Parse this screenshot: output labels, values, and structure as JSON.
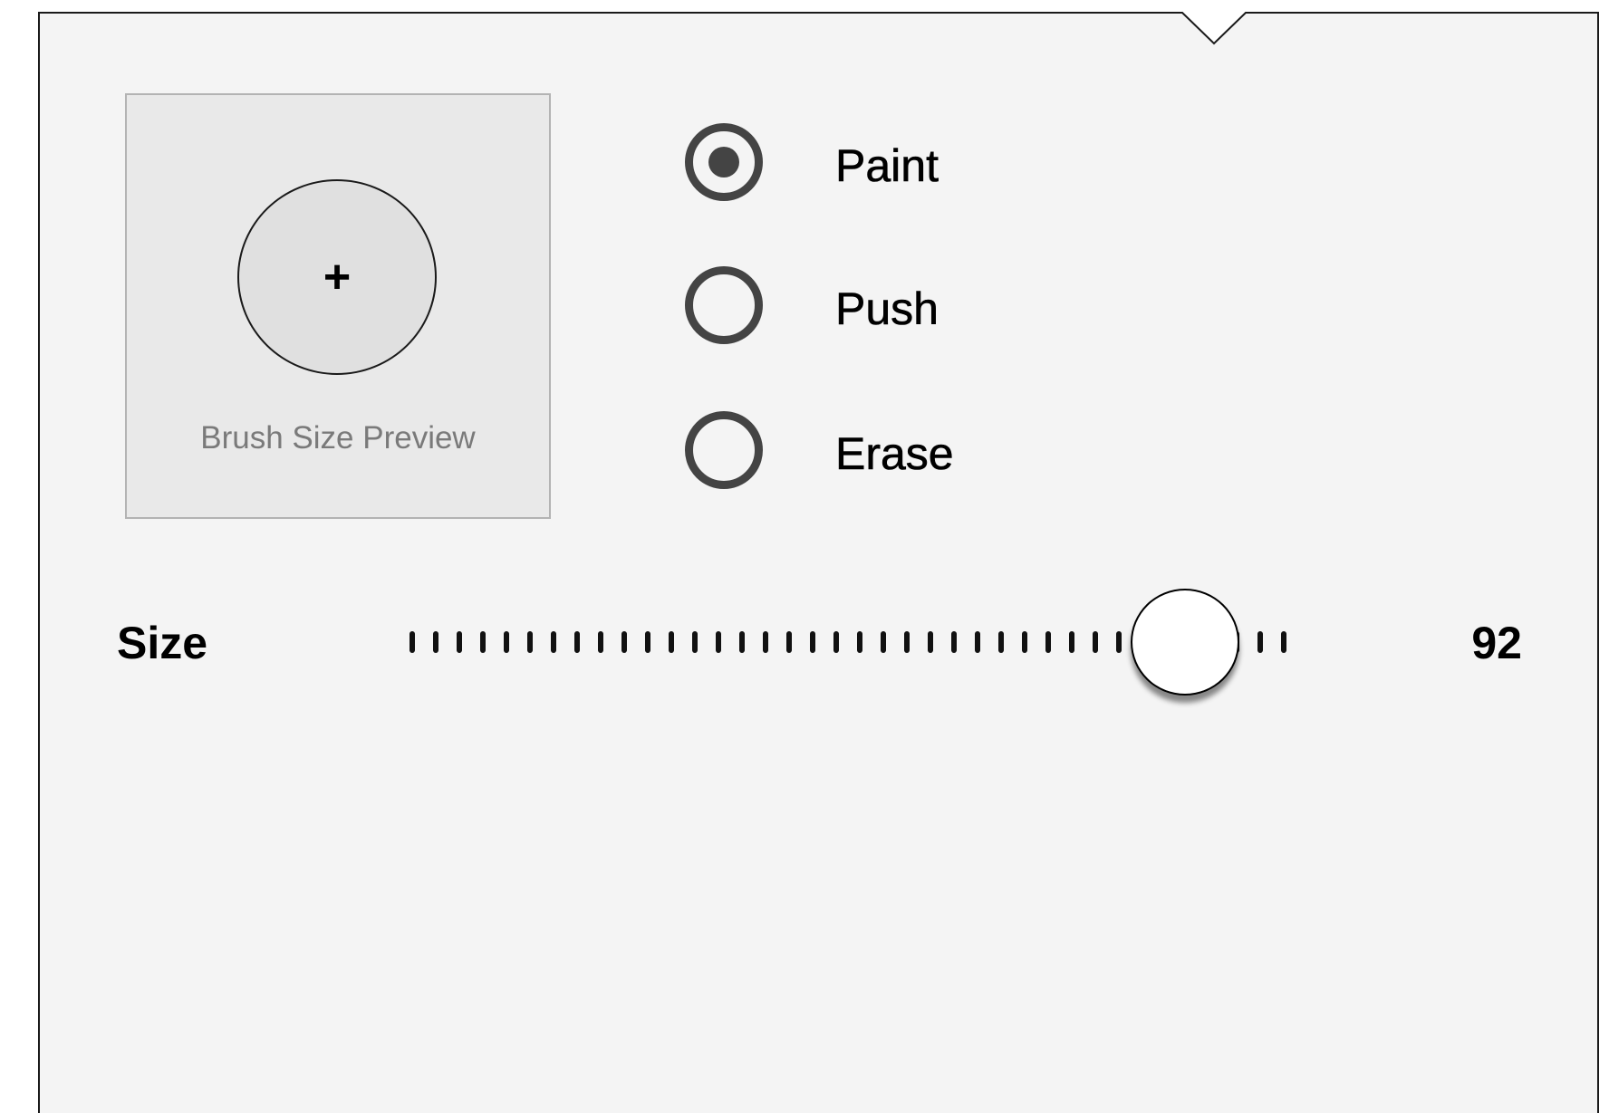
{
  "brush_popover": {
    "preview": {
      "label": "Brush Size Preview",
      "crosshair_glyph": "+"
    },
    "modes": [
      {
        "label": "Paint",
        "selected": true
      },
      {
        "label": "Push",
        "selected": false
      },
      {
        "label": "Erase",
        "selected": false
      }
    ],
    "size": {
      "label": "Size",
      "value": "92",
      "slider_fraction": 0.88
    }
  },
  "colors": {
    "panel_background": "#f4f4f4",
    "panel_border": "#1a1a1a",
    "preview_background": "#e9e9e9",
    "radio_color": "#444444"
  }
}
